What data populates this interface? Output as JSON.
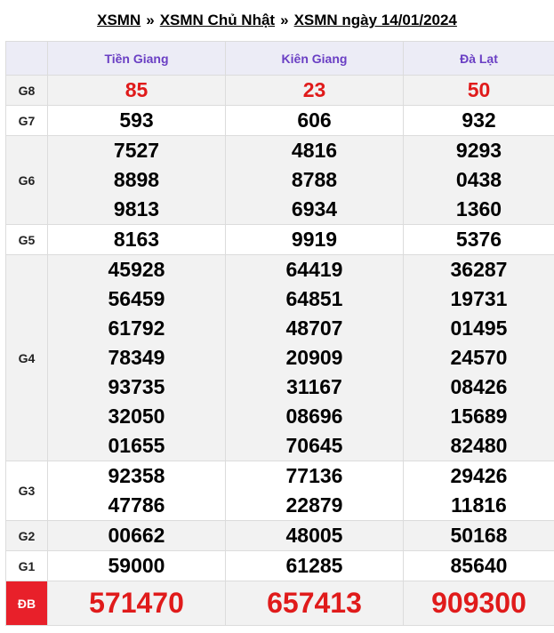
{
  "breadcrumb": {
    "item1": "XSMN",
    "item2": "XSMN Chủ Nhật",
    "item3": "XSMN ngày 14/01/2024",
    "separator": "»"
  },
  "provinces": [
    "Tiền Giang",
    "Kiên Giang",
    "Đà Lạt"
  ],
  "colors": {
    "header_text": "#6a3fc4",
    "highlight_red": "#e01b1b",
    "db_badge": "#e8202a"
  },
  "prizes": [
    {
      "label": "G8",
      "values": [
        [
          "85"
        ],
        [
          "23"
        ],
        [
          "50"
        ]
      ]
    },
    {
      "label": "G7",
      "values": [
        [
          "593"
        ],
        [
          "606"
        ],
        [
          "932"
        ]
      ]
    },
    {
      "label": "G6",
      "values": [
        [
          "7527",
          "8898",
          "9813"
        ],
        [
          "4816",
          "8788",
          "6934"
        ],
        [
          "9293",
          "0438",
          "1360"
        ]
      ]
    },
    {
      "label": "G5",
      "values": [
        [
          "8163"
        ],
        [
          "9919"
        ],
        [
          "5376"
        ]
      ]
    },
    {
      "label": "G4",
      "values": [
        [
          "45928",
          "56459",
          "61792",
          "78349",
          "93735",
          "32050",
          "01655"
        ],
        [
          "64419",
          "64851",
          "48707",
          "20909",
          "31167",
          "08696",
          "70645"
        ],
        [
          "36287",
          "19731",
          "01495",
          "24570",
          "08426",
          "15689",
          "82480"
        ]
      ]
    },
    {
      "label": "G3",
      "values": [
        [
          "92358",
          "47786"
        ],
        [
          "77136",
          "22879"
        ],
        [
          "29426",
          "11816"
        ]
      ]
    },
    {
      "label": "G2",
      "values": [
        [
          "00662"
        ],
        [
          "48005"
        ],
        [
          "50168"
        ]
      ]
    },
    {
      "label": "G1",
      "values": [
        [
          "59000"
        ],
        [
          "61285"
        ],
        [
          "85640"
        ]
      ]
    },
    {
      "label": "ĐB",
      "values": [
        [
          "571470"
        ],
        [
          "657413"
        ],
        [
          "909300"
        ]
      ]
    }
  ]
}
